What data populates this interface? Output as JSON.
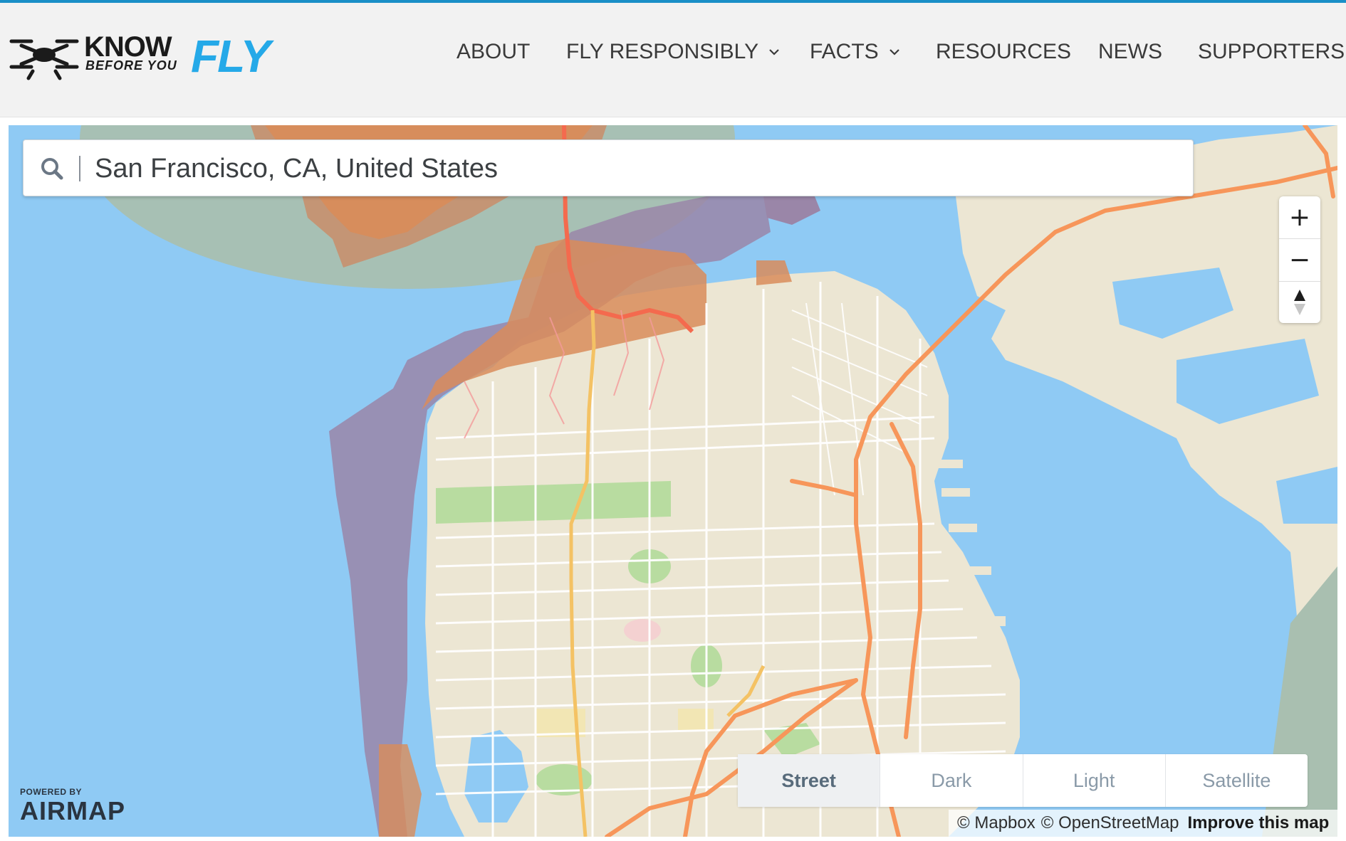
{
  "header": {
    "logo": {
      "know": "KNOW",
      "before_you": "BEFORE YOU",
      "fly": "FLY"
    },
    "nav": [
      {
        "label": "ABOUT",
        "dropdown": false
      },
      {
        "label": "FLY RESPONSIBLY",
        "dropdown": true
      },
      {
        "label": "FACTS",
        "dropdown": true
      },
      {
        "label": "RESOURCES",
        "dropdown": false
      },
      {
        "label": "NEWS",
        "dropdown": false
      },
      {
        "label": "SUPPORTERS",
        "dropdown": false
      }
    ]
  },
  "map": {
    "search": {
      "value": "San Francisco, CA, United States",
      "icon": "search-icon"
    },
    "zoom": {
      "in": "+",
      "out": "−",
      "compass_icon": "compass-icon"
    },
    "styles": [
      {
        "label": "Street",
        "active": true
      },
      {
        "label": "Dark",
        "active": false
      },
      {
        "label": "Light",
        "active": false
      },
      {
        "label": "Satellite",
        "active": false
      }
    ],
    "powered_by": "POWERED BY",
    "brand": "AIRMAP",
    "attribution": {
      "mapbox": "© Mapbox",
      "osm": "© OpenStreetMap",
      "improve": "Improve this map"
    },
    "colors": {
      "water": "#8fcaf4",
      "land": "#ece6d3",
      "park": "#b8dca0",
      "highway": "#f7965a",
      "airspace_purple": "#9a86a8",
      "airspace_orange": "#d98c5a",
      "accent": "#25a9e8"
    }
  }
}
